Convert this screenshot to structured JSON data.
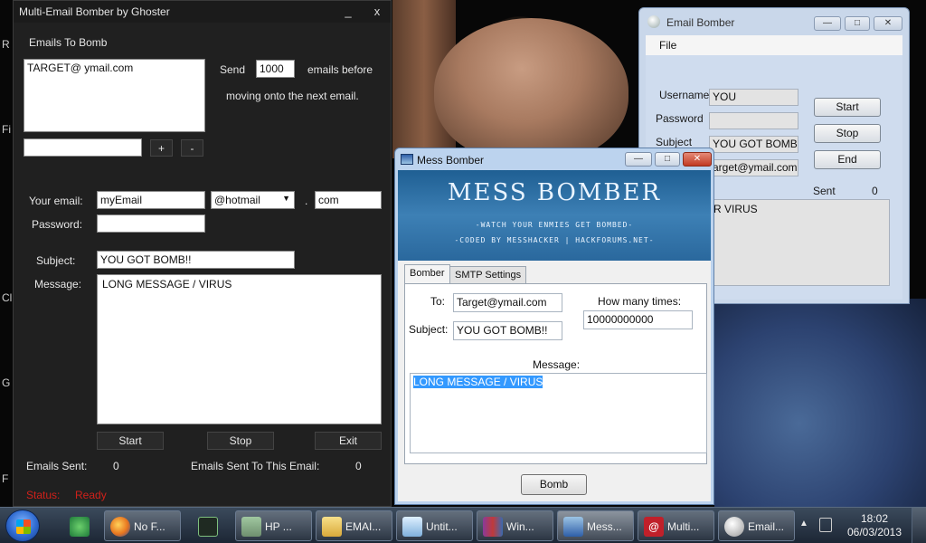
{
  "desktop": {
    "edge_letters": [
      "R",
      "Fi",
      "Cl",
      "G",
      "F"
    ]
  },
  "multi": {
    "title": "Multi-Email Bomber by Ghoster",
    "minimize": "_",
    "close": "x",
    "section_label": "Emails To Bomb",
    "targets_text": "TARGET@ ymail.com",
    "send_label": "Send",
    "send_count": "1000",
    "emails_before": "emails before",
    "moving_on": "moving onto the next email.",
    "add_field_value": "",
    "plus": "+",
    "minus": "-",
    "your_email_label": "Your email:",
    "your_email": "myEmail",
    "domain": "@hotmail",
    "dot": ".",
    "tld": "com",
    "password_label": "Password:",
    "password_value": "",
    "subject_label": "Subject:",
    "subject": "YOU GOT BOMB!!",
    "message_label": "Message:",
    "message": "LONG MESSAGE / VIRUS",
    "start": "Start",
    "stop": "Stop",
    "exit": "Exit",
    "emails_sent_label": "Emails Sent:",
    "emails_sent": "0",
    "sent_to_this_label": "Emails Sent To This Email:",
    "sent_to_this": "0",
    "status_label": "Status:",
    "status_value": "Ready"
  },
  "emailbomber": {
    "title": "Email Bomber",
    "minimize": "—",
    "maximize": "□",
    "close": "✕",
    "menu_file": "File",
    "username_label": "Username",
    "username": "YOU",
    "password_label": "Password",
    "password": "",
    "subject_label": "Subject",
    "subject": "YOU GOT BOMB!!",
    "target": "arget@ymail.com",
    "start": "Start",
    "stop": "Stop",
    "end": "End",
    "sent_label": "Sent",
    "sent": "0",
    "message": "R VIRUS"
  },
  "mess": {
    "title": "Mess Bomber",
    "minimize": "—",
    "maximize": "□",
    "close": "✕",
    "banner_title": "MESS BOMBER",
    "banner_line1": "-WATCH YOUR ENMIES GET BOMBED-",
    "banner_line2": "-CODED BY MESSHACKER | HACKFORUMS.NET-",
    "tab_bomber": "Bomber",
    "tab_smtp": "SMTP Settings",
    "to_label": "To:",
    "to": "Target@ymail.com",
    "subject_label": "Subject:",
    "subject": "YOU GOT BOMB!!",
    "times_label": "How many times:",
    "times": "10000000000",
    "message_label": "Message:",
    "message": "LONG MESSAGE / VIRUS",
    "bomb": "Bomb"
  },
  "taskbar": {
    "items": [
      {
        "label": "No F...",
        "color": "#e8761f"
      },
      {
        "label": "HP ...",
        "color": "#6f8f6f"
      },
      {
        "label": "EMAI...",
        "color": "#e6c25a"
      },
      {
        "label": "Untit...",
        "color": "#9cc4e4"
      },
      {
        "label": "Win...",
        "color": "#7a3a8a"
      },
      {
        "label": "Mess...",
        "color": "#2f5fa8"
      },
      {
        "label": "Multi...",
        "color": "#c0202a"
      },
      {
        "label": "Email...",
        "color": "#d8d8d8"
      }
    ],
    "time": "18:02",
    "date": "06/03/2013"
  }
}
